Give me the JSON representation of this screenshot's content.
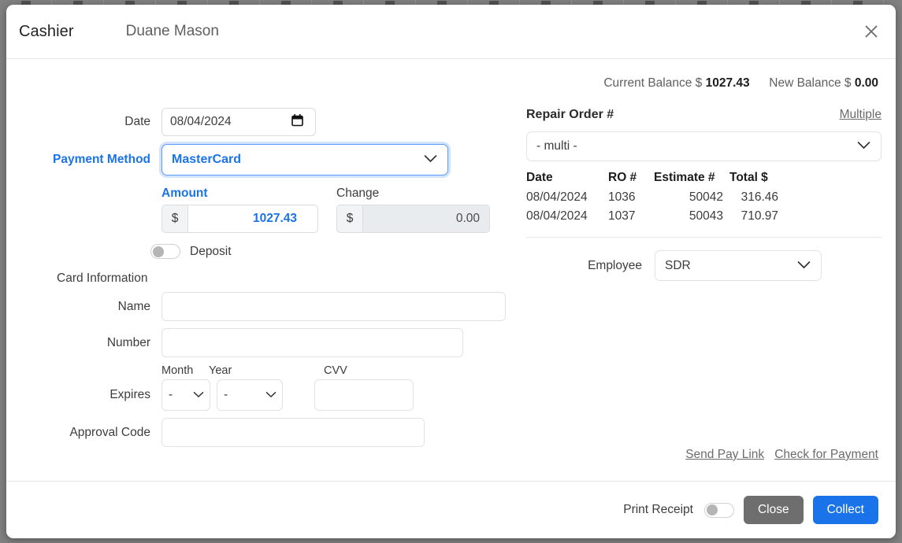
{
  "header": {
    "title": "Cashier",
    "customer_name": "Duane Mason",
    "close_icon": "close-icon"
  },
  "balances": {
    "current_label": "Current Balance $",
    "current_value": "1027.43",
    "new_label": "New Balance $",
    "new_value": "0.00"
  },
  "payment_form": {
    "date_label": "Date",
    "date_value": "08/04/2024",
    "payment_method_label": "Payment Method",
    "payment_method_value": "MasterCard",
    "amount_label": "Amount",
    "amount_prefix": "$",
    "amount_value": "1027.43",
    "change_label": "Change",
    "change_prefix": "$",
    "change_value": "0.00",
    "deposit_label": "Deposit",
    "deposit_on": false
  },
  "card_information": {
    "section_label": "Card Information",
    "name_label": "Name",
    "name_value": "",
    "number_label": "Number",
    "number_value": "",
    "month_caption": "Month",
    "year_caption": "Year",
    "cvv_caption": "CVV",
    "expires_label": "Expires",
    "month_value": "-",
    "year_value": "-",
    "cvv_value": "",
    "approval_label": "Approval Code",
    "approval_value": ""
  },
  "repair_order": {
    "title": "Repair Order #",
    "multiple_link": "Multiple",
    "select_value": "- multi -",
    "columns": [
      "Date",
      "RO #",
      "Estimate #",
      "Total $"
    ],
    "rows": [
      {
        "date": "08/04/2024",
        "ro": "1036",
        "estimate": "50042",
        "total": "316.46"
      },
      {
        "date": "08/04/2024",
        "ro": "1037",
        "estimate": "50043",
        "total": "710.97"
      }
    ]
  },
  "employee": {
    "label": "Employee",
    "value": "SDR"
  },
  "pay_links": {
    "send_pay_link": "Send Pay Link",
    "check_for_payment": "Check for Payment"
  },
  "footer": {
    "print_receipt_label": "Print Receipt",
    "print_receipt_on": false,
    "close_label": "Close",
    "collect_label": "Collect"
  },
  "colors": {
    "accent_blue": "#1a73e8",
    "close_gray": "#6e6e6e",
    "text_dark": "#3c3c3c",
    "muted": "#6b6b6b"
  }
}
